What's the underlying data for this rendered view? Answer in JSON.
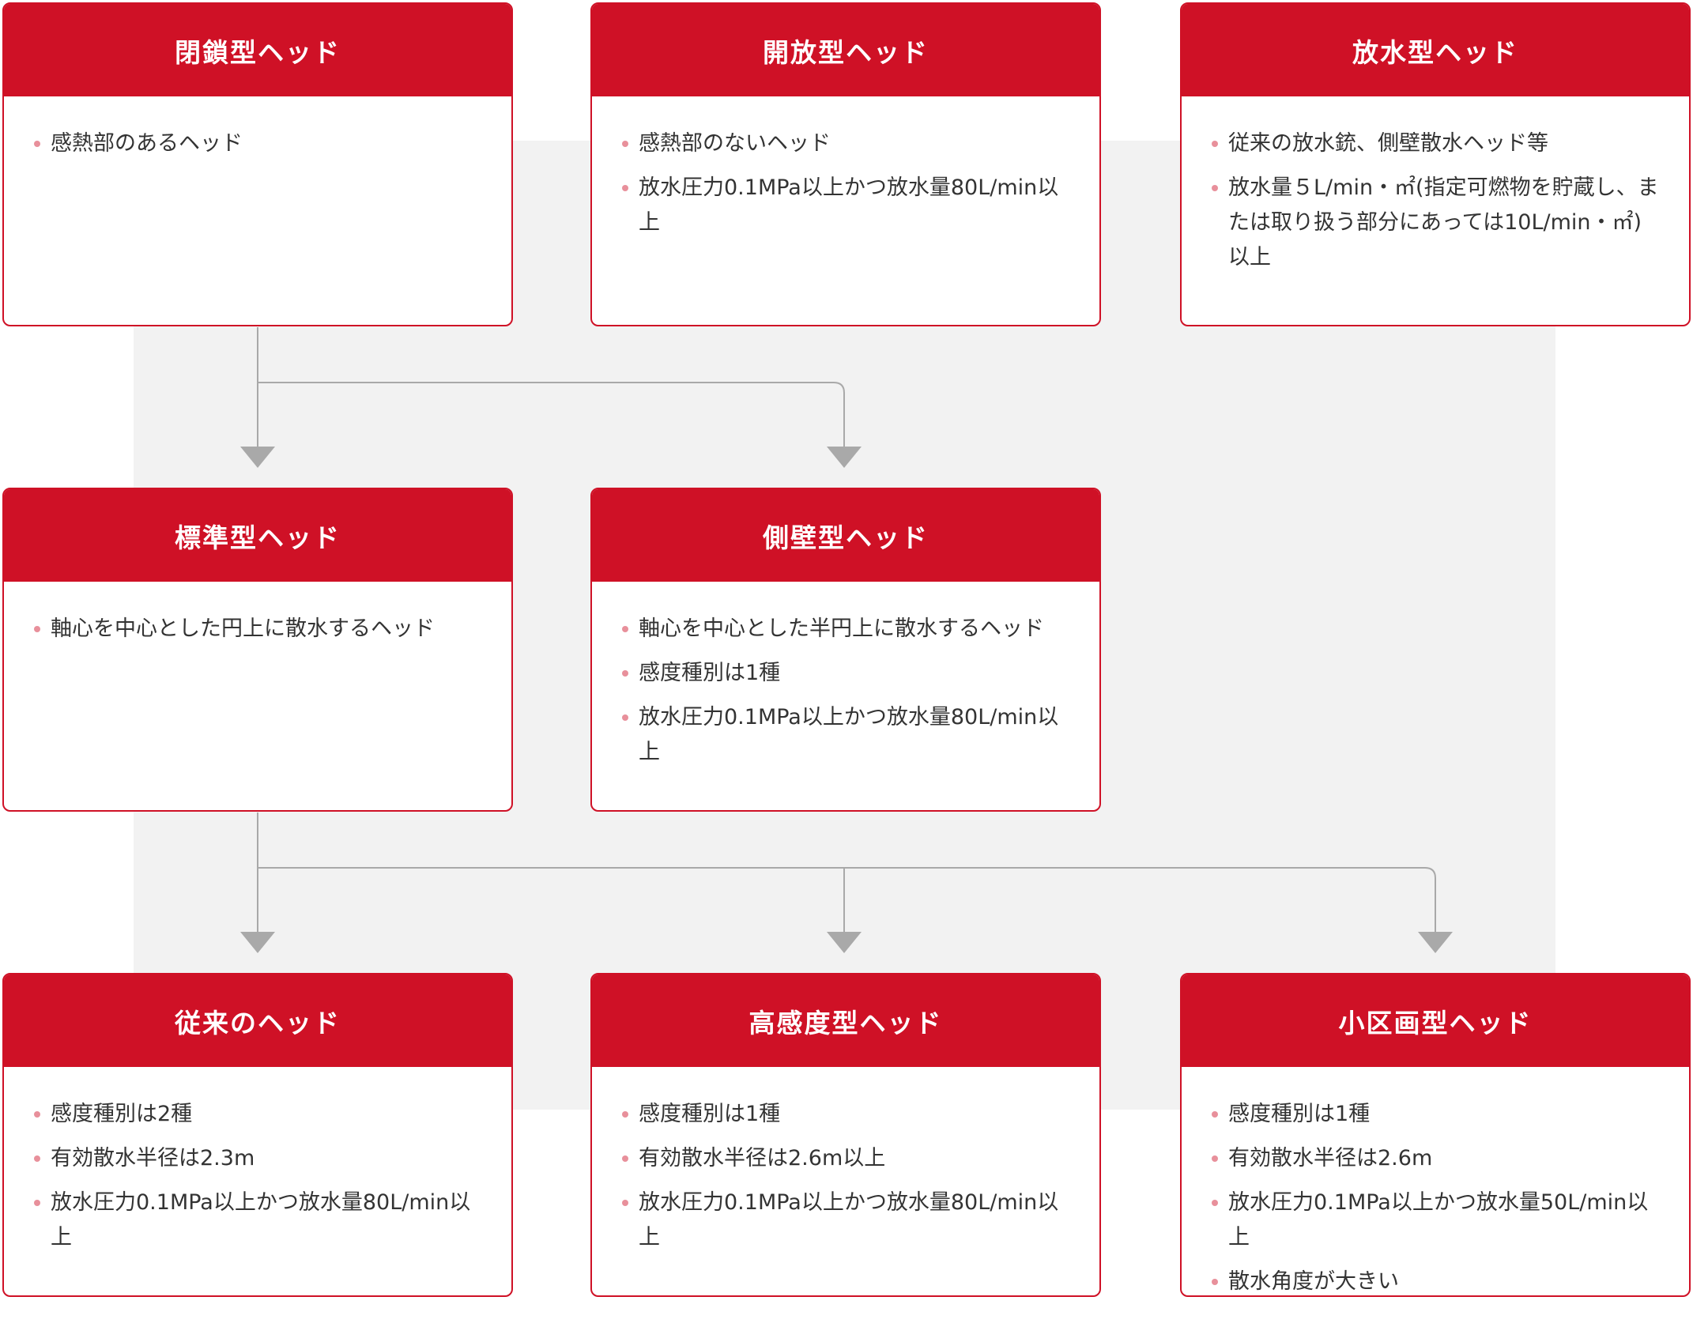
{
  "colors": {
    "accent": "#cf1126",
    "bullet": "#e8909b",
    "connector": "#a9a9a9",
    "panel": "#f2f2f2"
  },
  "cards": {
    "closed": {
      "title": "閉鎖型ヘッド",
      "items": [
        "感熱部のあるヘッド"
      ]
    },
    "open": {
      "title": "開放型ヘッド",
      "items": [
        "感熱部のないヘッド",
        "放水圧力0.1MPa以上かつ放水量80L/min以上"
      ]
    },
    "discharge": {
      "title": "放水型ヘッド",
      "items": [
        "従来の放水銃、側壁散水ヘッド等",
        "放水量５L/min・㎡(指定可燃物を貯蔵し、または取り扱う部分にあっては10L/min・㎡)以上"
      ]
    },
    "standard": {
      "title": "標準型ヘッド",
      "items": [
        "軸心を中心とした円上に散水するヘッド"
      ]
    },
    "sidewall": {
      "title": "側壁型ヘッド",
      "items": [
        "軸心を中心とした半円上に散水するヘッド",
        "感度種別は1種",
        "放水圧力0.1MPa以上かつ放水量80L/min以上"
      ]
    },
    "conventional": {
      "title": "従来のヘッド",
      "items": [
        "感度種別は2種",
        "有効散水半径は2.3m",
        "放水圧力0.1MPa以上かつ放水量80L/min以上"
      ]
    },
    "high_sensitivity": {
      "title": "高感度型ヘッド",
      "items": [
        "感度種別は1種",
        "有効散水半径は2.6m以上",
        "放水圧力0.1MPa以上かつ放水量80L/min以上"
      ]
    },
    "small_zone": {
      "title": "小区画型ヘッド",
      "items": [
        "感度種別は1種",
        "有効散水半径は2.6m",
        "放水圧力0.1MPa以上かつ放水量50L/min以上",
        "散水角度が大きい"
      ]
    }
  }
}
